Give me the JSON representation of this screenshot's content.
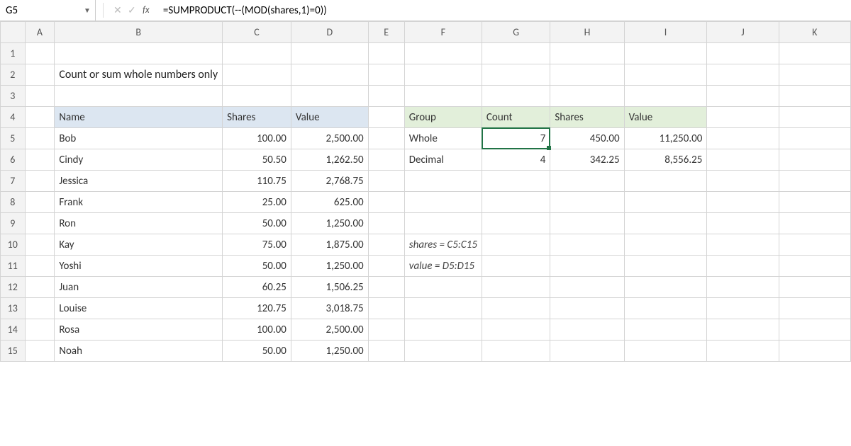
{
  "namebox": "G5",
  "formula": "=SUMPRODUCT(--(MOD(shares,1)=0))",
  "columns": [
    "A",
    "B",
    "C",
    "D",
    "E",
    "F",
    "G",
    "H",
    "I",
    "J",
    "K"
  ],
  "rows": [
    "1",
    "2",
    "3",
    "4",
    "5",
    "6",
    "7",
    "8",
    "9",
    "10",
    "11",
    "12",
    "13",
    "14",
    "15"
  ],
  "active": {
    "col": "G",
    "row": "5"
  },
  "title": "Count or sum whole numbers only",
  "table1": {
    "headers": {
      "name": "Name",
      "shares": "Shares",
      "value": "Value"
    },
    "rows": [
      {
        "name": "Bob",
        "shares": "100.00",
        "value": "2,500.00"
      },
      {
        "name": "Cindy",
        "shares": "50.50",
        "value": "1,262.50"
      },
      {
        "name": "Jessica",
        "shares": "110.75",
        "value": "2,768.75"
      },
      {
        "name": "Frank",
        "shares": "25.00",
        "value": "625.00"
      },
      {
        "name": "Ron",
        "shares": "50.00",
        "value": "1,250.00"
      },
      {
        "name": "Kay",
        "shares": "75.00",
        "value": "1,875.00"
      },
      {
        "name": "Yoshi",
        "shares": "50.00",
        "value": "1,250.00"
      },
      {
        "name": "Juan",
        "shares": "60.25",
        "value": "1,506.25"
      },
      {
        "name": "Louise",
        "shares": "120.75",
        "value": "3,018.75"
      },
      {
        "name": "Rosa",
        "shares": "100.00",
        "value": "2,500.00"
      },
      {
        "name": "Noah",
        "shares": "50.00",
        "value": "1,250.00"
      }
    ]
  },
  "table2": {
    "headers": {
      "group": "Group",
      "count": "Count",
      "shares": "Shares",
      "value": "Value"
    },
    "rows": [
      {
        "group": "Whole",
        "count": "7",
        "shares": "450.00",
        "value": "11,250.00"
      },
      {
        "group": "Decimal",
        "count": "4",
        "shares": "342.25",
        "value": "8,556.25"
      }
    ]
  },
  "notes": {
    "line1": "shares = C5:C15",
    "line2": "value = D5:D15"
  }
}
